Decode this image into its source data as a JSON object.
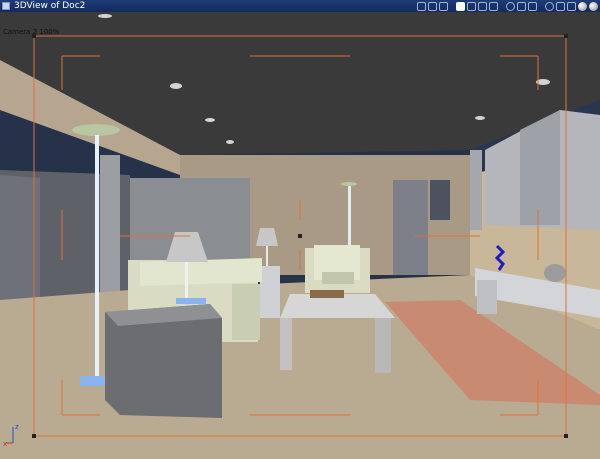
{
  "window": {
    "title": "3DView of Doc2",
    "icon": "3d-view-icon"
  },
  "toolbar": {
    "buttons": [
      {
        "name": "pan-view-icon"
      },
      {
        "name": "walk-view-icon"
      },
      {
        "name": "camera-view-icon"
      },
      {
        "name": "render-mode-icon"
      },
      {
        "name": "wireframe-icon"
      },
      {
        "name": "hidden-line-icon"
      },
      {
        "name": "shaded-icon"
      },
      {
        "name": "texture-icon"
      },
      {
        "name": "view-orbit-icon"
      },
      {
        "name": "view-zoom-icon"
      },
      {
        "name": "view-cube-icon"
      },
      {
        "name": "light-icon"
      },
      {
        "name": "target-icon"
      },
      {
        "name": "move-icon"
      },
      {
        "name": "bounding-box-icon"
      },
      {
        "name": "cube-icon"
      },
      {
        "name": "sphere-icon"
      },
      {
        "name": "material-sphere-icon"
      }
    ]
  },
  "viewport": {
    "camera_label": "Camera 2 100%",
    "axis_labels": {
      "x": "x",
      "z": "z"
    }
  },
  "colors": {
    "titlebar": "#1f3c78",
    "ceiling": "#3a3a3a",
    "floor": "#b8ab92",
    "wall_back": "#a99a86",
    "rug": "#c98a72",
    "frame_lines": "#e0703a",
    "sofa": "#d9dcc3",
    "table": "#c9c9c9",
    "sky": "#26324a"
  }
}
